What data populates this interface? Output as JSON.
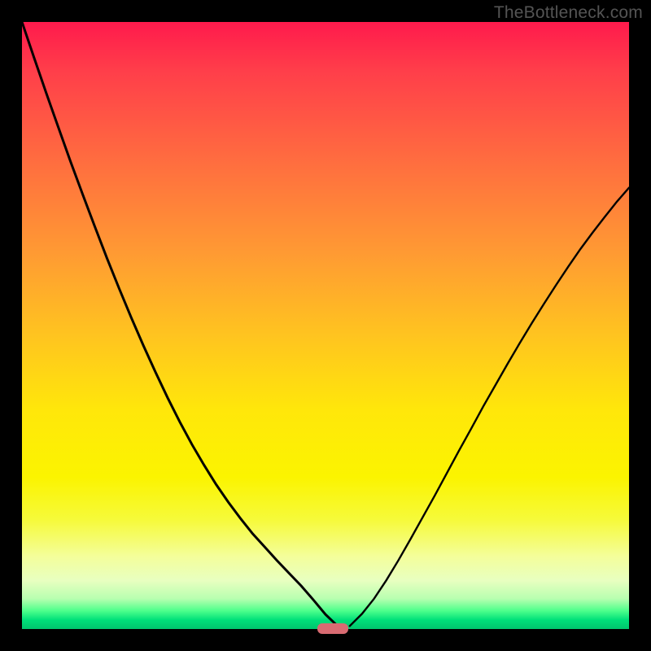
{
  "watermark": "TheBottleneck.com",
  "colors": {
    "frame": "#000000",
    "curve": "#000000",
    "marker": "#d96b72"
  },
  "layout": {
    "image_size": 800,
    "border": 27,
    "plot_size": 746
  },
  "chart_data": {
    "type": "line",
    "title": "",
    "xlabel": "",
    "ylabel": "",
    "xlim": [
      0,
      100
    ],
    "ylim": [
      0,
      100
    ],
    "x": [
      0,
      2,
      4,
      6,
      8,
      10,
      12,
      14,
      16,
      18,
      20,
      22,
      24,
      26,
      28,
      30,
      32,
      34,
      36,
      38,
      40,
      42,
      44,
      46,
      48,
      50,
      52,
      54,
      56,
      58,
      60,
      62,
      64,
      66,
      68,
      70,
      72,
      74,
      76,
      78,
      80,
      82,
      84,
      86,
      88,
      90,
      92,
      94,
      96,
      98,
      100
    ],
    "series": [
      {
        "name": "left_branch",
        "values": [
          100,
          94.1,
          88.3,
          82.6,
          77.0,
          71.6,
          66.3,
          61.1,
          56.1,
          51.3,
          46.7,
          42.3,
          38.1,
          34.1,
          30.4,
          27.0,
          23.8,
          20.9,
          18.2,
          15.7,
          13.5,
          11.3,
          9.2,
          7.1,
          4.8,
          2.4,
          0.5,
          null,
          null,
          null,
          null,
          null,
          null,
          null,
          null,
          null,
          null,
          null,
          null,
          null,
          null,
          null,
          null,
          null,
          null,
          null,
          null,
          null,
          null,
          null,
          null
        ]
      },
      {
        "name": "right_branch",
        "values": [
          null,
          null,
          null,
          null,
          null,
          null,
          null,
          null,
          null,
          null,
          null,
          null,
          null,
          null,
          null,
          null,
          null,
          null,
          null,
          null,
          null,
          null,
          null,
          null,
          null,
          null,
          null,
          0.5,
          2.5,
          5.0,
          8.0,
          11.3,
          14.8,
          18.4,
          22.0,
          25.7,
          29.4,
          33.0,
          36.7,
          40.2,
          43.7,
          47.1,
          50.4,
          53.6,
          56.7,
          59.7,
          62.6,
          65.3,
          67.9,
          70.4,
          72.7
        ]
      }
    ],
    "marker": {
      "x_center": 51.2,
      "y": 0.2,
      "width_pct": 5.2
    },
    "grid": false,
    "legend": false
  }
}
